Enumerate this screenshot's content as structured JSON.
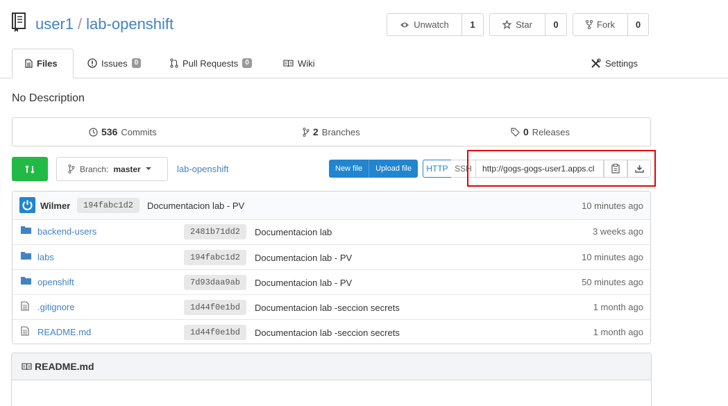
{
  "repo": {
    "owner": "user1",
    "separator": "/",
    "name": "lab-openshift"
  },
  "actions": {
    "watch": {
      "label": "Unwatch",
      "count": "1"
    },
    "star": {
      "label": "Star",
      "count": "0"
    },
    "fork": {
      "label": "Fork",
      "count": "0"
    }
  },
  "tabs": {
    "files": "Files",
    "issues": {
      "label": "Issues",
      "count": "0"
    },
    "pulls": {
      "label": "Pull Requests",
      "count": "0"
    },
    "wiki": "Wiki",
    "settings": "Settings"
  },
  "description": "No Description",
  "stats": {
    "commits": {
      "count": "536",
      "label": "Commits"
    },
    "branches": {
      "count": "2",
      "label": "Branches"
    },
    "releases": {
      "count": "0",
      "label": "Releases"
    }
  },
  "branch": {
    "prefix": "Branch:",
    "name": "master"
  },
  "breadcrumb": "lab-openshift",
  "file_actions": {
    "new_file": "New file",
    "upload_file": "Upload file"
  },
  "clone": {
    "http": "HTTP",
    "ssh": "SSH",
    "url": "http://gogs-gogs-user1.apps.cl"
  },
  "latest_commit": {
    "author": "Wilmer",
    "sha": "194fabc1d2",
    "message": "Documentacion lab - PV",
    "time": "10 minutes ago"
  },
  "files": [
    {
      "type": "folder",
      "name": "backend-users",
      "sha": "2481b71dd2",
      "message": "Documentacion lab",
      "time": "3 weeks ago"
    },
    {
      "type": "folder",
      "name": "labs",
      "sha": "194fabc1d2",
      "message": "Documentacion lab - PV",
      "time": "10 minutes ago"
    },
    {
      "type": "folder",
      "name": "openshift",
      "sha": "7d93daa9ab",
      "message": "Documentacion lab - PV",
      "time": "50 minutes ago"
    },
    {
      "type": "file",
      "name": ".gitignore",
      "sha": "1d44f0e1bd",
      "message": "Documentacion lab -seccion secrets",
      "time": "1 month ago"
    },
    {
      "type": "file",
      "name": "README.md",
      "sha": "1d44f0e1bd",
      "message": "Documentacion lab -seccion secrets",
      "time": "1 month ago"
    }
  ],
  "readme": {
    "title": "README.md"
  },
  "colors": {
    "link": "#4183c4",
    "primary": "#2185d0",
    "green": "#21ba45",
    "highlight": "#e30000"
  }
}
